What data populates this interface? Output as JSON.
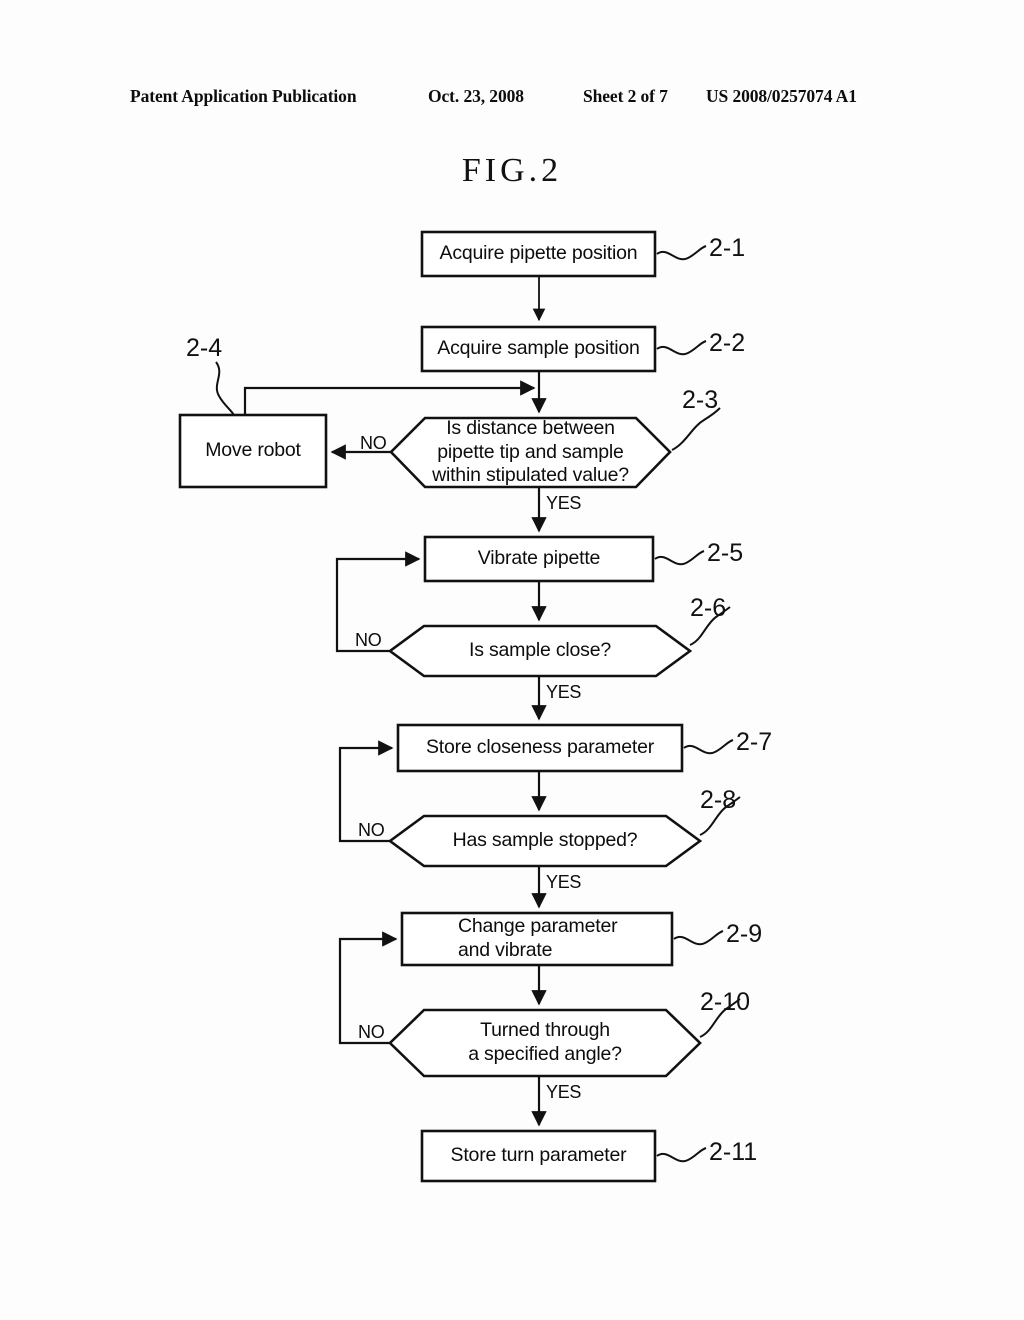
{
  "header": {
    "publication": "Patent Application Publication",
    "date": "Oct. 23, 2008",
    "sheet": "Sheet 2 of 7",
    "document_number": "US 2008/0257074 A1"
  },
  "figure": {
    "title": "FIG.2"
  },
  "chart_data": {
    "type": "diagram",
    "diagram_kind": "flowchart",
    "title": "FIG.2",
    "orientation": "top-to-bottom",
    "nodes": [
      {
        "id": "2-1",
        "ref": "2-1",
        "shape": "rectangle",
        "text": "Acquire pipette position"
      },
      {
        "id": "2-2",
        "ref": "2-2",
        "shape": "rectangle",
        "text": "Acquire sample position"
      },
      {
        "id": "2-3",
        "ref": "2-3",
        "shape": "hexagon",
        "text": "Is distance between\npipette tip and sample\nwithin stipulated value?"
      },
      {
        "id": "2-4",
        "ref": "2-4",
        "shape": "rectangle",
        "text": "Move robot"
      },
      {
        "id": "2-5",
        "ref": "2-5",
        "shape": "rectangle",
        "text": "Vibrate pipette"
      },
      {
        "id": "2-6",
        "ref": "2-6",
        "shape": "hexagon",
        "text": "Is sample close?"
      },
      {
        "id": "2-7",
        "ref": "2-7",
        "shape": "rectangle",
        "text": "Store closeness parameter"
      },
      {
        "id": "2-8",
        "ref": "2-8",
        "shape": "hexagon",
        "text": "Has sample stopped?"
      },
      {
        "id": "2-9",
        "ref": "2-9",
        "shape": "rectangle",
        "text": "Change parameter\nand vibrate"
      },
      {
        "id": "2-10",
        "ref": "2-10",
        "shape": "hexagon",
        "text": "Turned through\na specified angle?"
      },
      {
        "id": "2-11",
        "ref": "2-11",
        "shape": "rectangle",
        "text": "Store turn parameter"
      }
    ],
    "edges": [
      {
        "from": "2-1",
        "to": "2-2",
        "label": ""
      },
      {
        "from": "2-2",
        "to": "2-3",
        "label": ""
      },
      {
        "from": "2-3",
        "to": "2-4",
        "label": "NO"
      },
      {
        "from": "2-4",
        "to": "2-3",
        "label": ""
      },
      {
        "from": "2-3",
        "to": "2-5",
        "label": "YES"
      },
      {
        "from": "2-5",
        "to": "2-6",
        "label": ""
      },
      {
        "from": "2-6",
        "to": "2-5",
        "label": "NO"
      },
      {
        "from": "2-6",
        "to": "2-7",
        "label": "YES"
      },
      {
        "from": "2-7",
        "to": "2-8",
        "label": ""
      },
      {
        "from": "2-8",
        "to": "2-7",
        "label": "NO"
      },
      {
        "from": "2-8",
        "to": "2-9",
        "label": "YES"
      },
      {
        "from": "2-9",
        "to": "2-10",
        "label": ""
      },
      {
        "from": "2-10",
        "to": "2-9",
        "label": "NO"
      },
      {
        "from": "2-10",
        "to": "2-11",
        "label": "YES"
      }
    ],
    "edge_labels": {
      "no_3": "NO",
      "yes_3": "YES",
      "no_6": "NO",
      "yes_6": "YES",
      "no_8": "NO",
      "yes_8": "YES",
      "no_10": "NO",
      "yes_10": "YES"
    },
    "colors": {
      "stroke": "#111111",
      "background": "#fdfdfd",
      "text": "#0d0d0d"
    }
  }
}
